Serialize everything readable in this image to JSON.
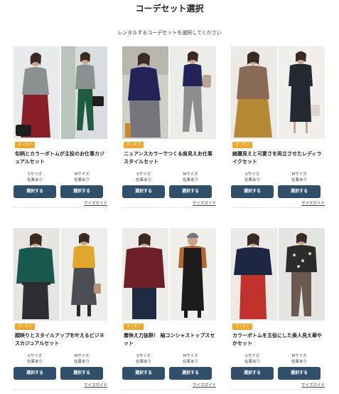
{
  "page": {
    "title": "コーデセット選択",
    "subtitle": "レンタルするコーデセットを選択してください"
  },
  "cards": [
    {
      "badge": "オンオフ",
      "title": "旬柄とカラーボトムが主役のお仕事カジュアルセット",
      "s_size": "Sサイズ",
      "s_stock": "在庫あり",
      "m_size": "Mサイズ",
      "m_stock": "在庫あり",
      "select_s": "選択する",
      "select_m": "選択する",
      "size_guide": "サイズガイド"
    },
    {
      "badge": "オンオフ",
      "title": "ニュアンスカラーでつくる肩見えお仕事スタイルセット",
      "s_size": "Sサイズ",
      "s_stock": "在庫あり",
      "m_size": "Mサイズ",
      "m_stock": "在庫あり",
      "select_s": "選択する",
      "select_m": "選択する",
      "size_guide": "サイズガイド"
    },
    {
      "badge": "オンオフ",
      "title": "綺麗見えと可愛さを両立させたレディライクセット",
      "s_size": "Sサイズ",
      "s_stock": "在庫あり",
      "m_size": "Mサイズ",
      "m_stock": "在庫あり",
      "select_s": "選択する",
      "select_m": "選択する",
      "size_guide": "サイズガイド"
    },
    {
      "badge": "オンオフ",
      "title": "顔映りとスタイルアップを叶えるビジネスカジュアルセット",
      "s_size": "Sサイズ",
      "s_stock": "在庫あり",
      "m_size": "Mサイズ",
      "m_stock": "在庫あり",
      "select_s": "選択する",
      "select_m": "選択する",
      "size_guide": "サイズガイド"
    },
    {
      "badge": "オンオフ",
      "title": "着映え力抜群！ 袖コンシャストップスセット",
      "s_size": "Sサイズ",
      "s_stock": "在庫あり",
      "m_size": "Mサイズ",
      "m_stock": "在庫あり",
      "select_s": "選択する",
      "select_m": "選択する",
      "size_guide": "サイズガイド"
    },
    {
      "badge": "オンオフ",
      "title": "カラーボトムを主役にした美人見え華やかセット",
      "s_size": "Sサイズ",
      "s_stock": "在庫あり",
      "m_size": "Mサイズ",
      "m_stock": "在庫あり",
      "select_s": "選択する",
      "select_m": "選択する",
      "size_guide": "サイズガイド"
    }
  ],
  "colors": {
    "button": "#2f4f6b",
    "badge": "#f1a827"
  }
}
